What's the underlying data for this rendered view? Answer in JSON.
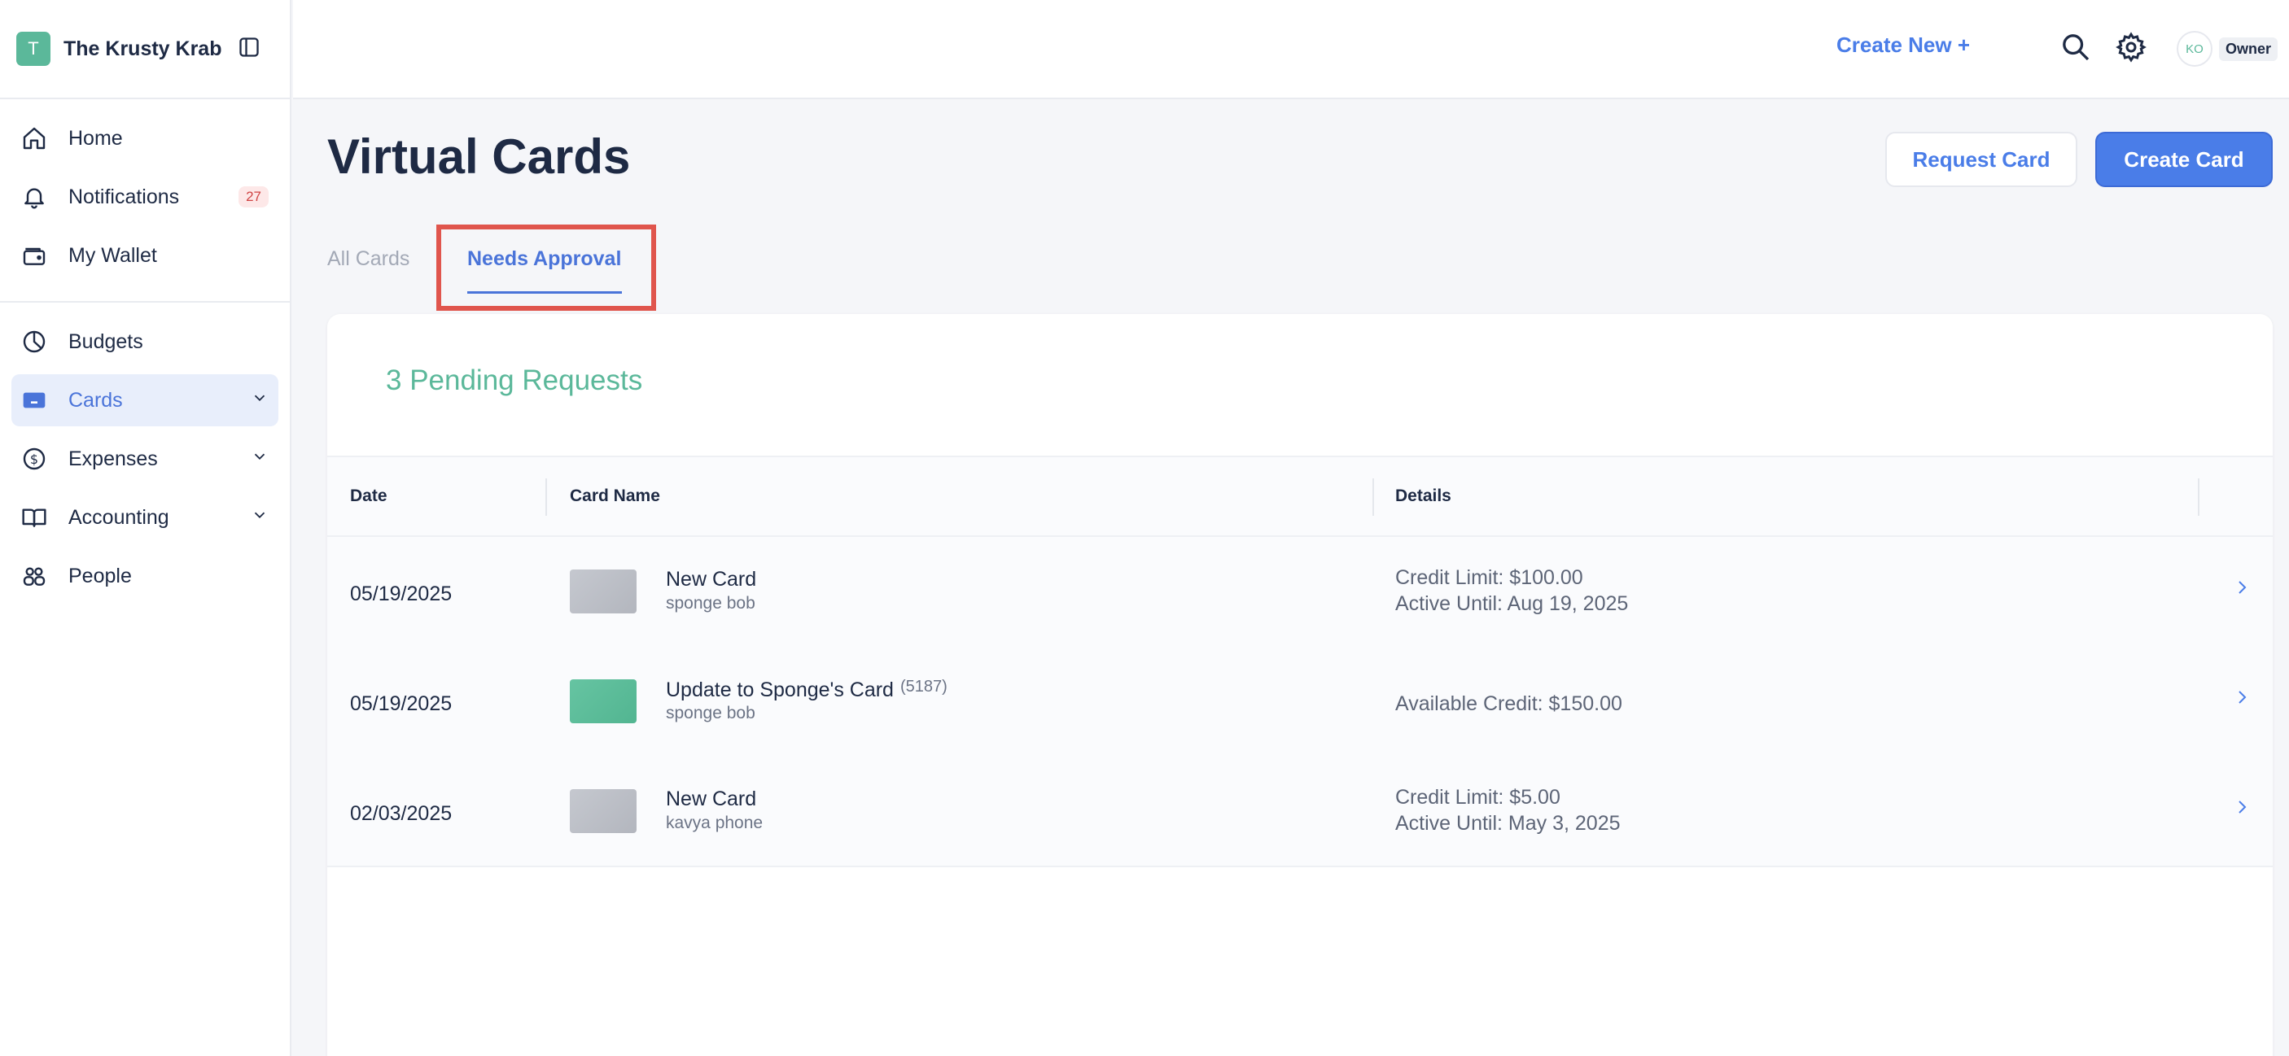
{
  "brand": {
    "initial": "T",
    "name": "The Krusty Krab"
  },
  "sidebar": {
    "groups": [
      [
        {
          "label": "Home",
          "icon": "home-icon"
        },
        {
          "label": "Notifications",
          "icon": "bell-icon",
          "badge": "27"
        },
        {
          "label": "My Wallet",
          "icon": "wallet-icon"
        }
      ],
      [
        {
          "label": "Budgets",
          "icon": "pie-chart-icon"
        },
        {
          "label": "Cards",
          "icon": "credit-card-icon",
          "active": true,
          "expandable": true
        },
        {
          "label": "Expenses",
          "icon": "dollar-circle-icon",
          "expandable": true
        },
        {
          "label": "Accounting",
          "icon": "book-icon",
          "expandable": true
        },
        {
          "label": "People",
          "icon": "people-icon"
        }
      ]
    ]
  },
  "topbar": {
    "create_new": "Create New +",
    "user_initials": "KO",
    "role": "Owner"
  },
  "page": {
    "title": "Virtual Cards",
    "request_button": "Request Card",
    "create_button": "Create Card",
    "tabs": [
      {
        "label": "All Cards",
        "active": false
      },
      {
        "label": "Needs Approval",
        "active": true
      }
    ],
    "pending_summary": "3 Pending Requests"
  },
  "table": {
    "columns": [
      "Date",
      "Card Name",
      "Details"
    ],
    "rows": [
      {
        "date": "05/19/2025",
        "card_name": "New Card",
        "card_number": "",
        "owner": "sponge bob",
        "thumb": "gray",
        "details": [
          "Credit Limit: $100.00",
          "Active Until: Aug 19, 2025"
        ]
      },
      {
        "date": "05/19/2025",
        "card_name": "Update to Sponge's Card",
        "card_number": "(5187)",
        "owner": "sponge bob",
        "thumb": "green",
        "details": [
          "Available Credit: $150.00"
        ]
      },
      {
        "date": "02/03/2025",
        "card_name": "New Card",
        "card_number": "",
        "owner": "kavya phone",
        "thumb": "gray",
        "details": [
          "Credit Limit: $5.00",
          "Active Until: May 3, 2025"
        ]
      }
    ]
  },
  "colors": {
    "accent": "#4a7de8",
    "brand_green": "#5bb89a",
    "highlight": "#e0554d"
  }
}
